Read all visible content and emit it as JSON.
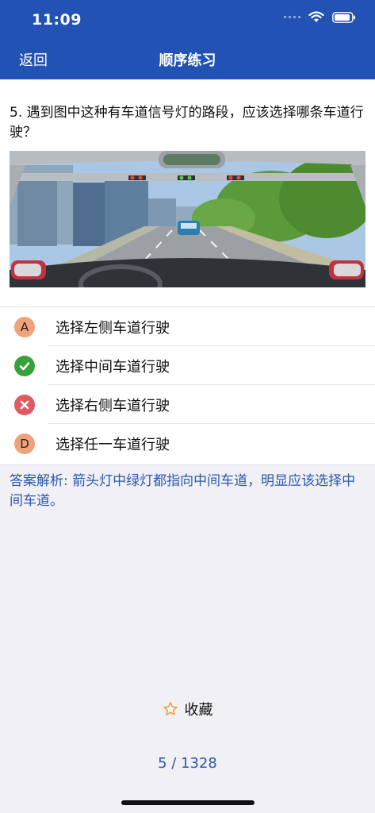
{
  "status": {
    "time": "11:09"
  },
  "nav": {
    "back_label": "返回",
    "title": "顺序练习"
  },
  "question": {
    "text": "5. 遇到图中这种有车道信号灯的路段，应该选择哪条车道行驶？"
  },
  "options": [
    {
      "letter": "A",
      "label": "选择左侧车道行驶",
      "state": "default"
    },
    {
      "letter": "",
      "label": "选择中间车道行驶",
      "state": "correct"
    },
    {
      "letter": "",
      "label": "选择右侧车道行驶",
      "state": "wrong"
    },
    {
      "letter": "D",
      "label": "选择任一车道行驶",
      "state": "default"
    }
  ],
  "explanation": "答案解析: 箭头灯中绿灯都指向中间车道，明显应该选择中间车道。",
  "favorite_label": "收藏",
  "pager": "5 / 1328",
  "colors": {
    "header": "#2152b4",
    "option_default": "#f0a37a",
    "correct": "#3aa13a",
    "wrong": "#e05a63",
    "accent_text": "#2c58b0",
    "star": "#e6a23c"
  }
}
